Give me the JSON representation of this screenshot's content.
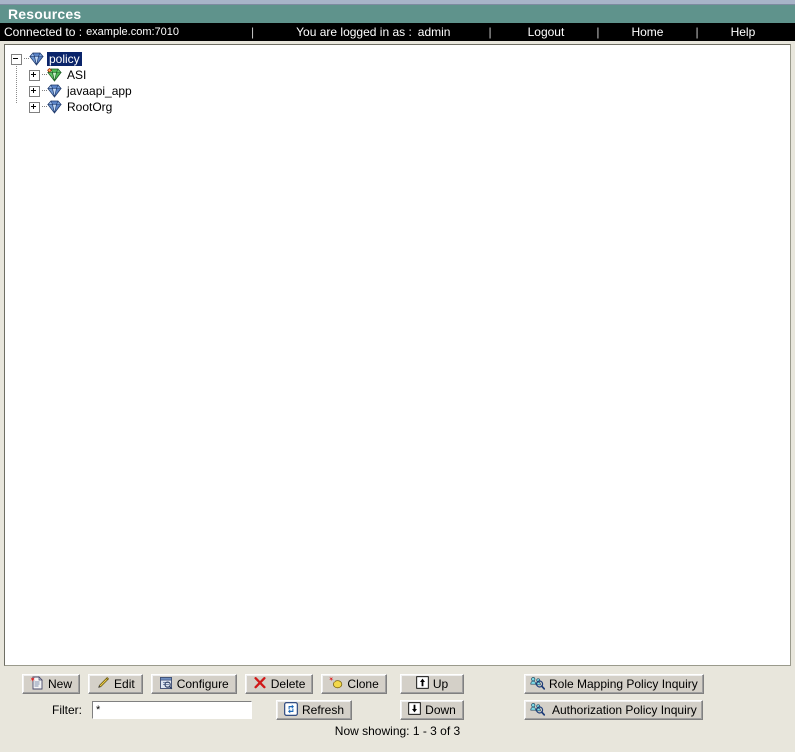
{
  "window": {
    "title": "Resources",
    "title_bar_color": "#5f938c",
    "top_strip_color": "#a8b4c8"
  },
  "nav": {
    "connected_label": "Connected to :",
    "connected_value": "example.com:7010",
    "separator": "|",
    "logged_in_label": "You are logged in as :",
    "logged_in_user": "admin",
    "links": [
      {
        "label": "Logout",
        "name": "logout"
      },
      {
        "label": "Home",
        "name": "home"
      },
      {
        "label": "Help",
        "name": "help"
      }
    ]
  },
  "tree": {
    "root": {
      "label": "policy",
      "selected": true,
      "expanded": true,
      "icon": "blue-gem-icon",
      "toggle": "minus"
    },
    "children": [
      {
        "label": "ASI",
        "icon": "green-gem-icon",
        "toggle": "plus",
        "badge": "red-diamond-badge"
      },
      {
        "label": "javaapi_app",
        "icon": "blue-gem-icon",
        "toggle": "plus"
      },
      {
        "label": "RootOrg",
        "icon": "blue-gem-icon",
        "toggle": "plus"
      }
    ]
  },
  "toolbar": {
    "buttons_row1": [
      {
        "label": "New",
        "icon": "new-document-icon"
      },
      {
        "label": "Edit",
        "icon": "pencil-icon"
      },
      {
        "label": "Configure",
        "icon": "configure-window-icon"
      },
      {
        "label": "Delete",
        "icon": "red-x-icon"
      },
      {
        "label": "Clone",
        "icon": "clone-icon"
      },
      {
        "label": "Up",
        "icon": "arrow-up-icon"
      }
    ],
    "inquiry_buttons": [
      {
        "label": "Role Mapping Policy Inquiry",
        "icon": "policy-inquiry-icon"
      },
      {
        "label": "Authorization Policy Inquiry",
        "icon": "policy-inquiry-icon"
      }
    ],
    "down_button": {
      "label": "Down",
      "icon": "arrow-down-icon"
    },
    "refresh_button": {
      "label": "Refresh",
      "icon": "refresh-icon"
    },
    "filter_label": "Filter:",
    "filter_value": "*",
    "filter_placeholder": ""
  },
  "status": {
    "now_showing": "Now showing: 1 - 3 of 3"
  }
}
